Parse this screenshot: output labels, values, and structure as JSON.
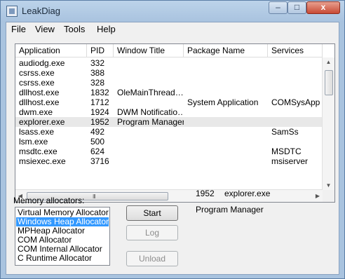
{
  "window": {
    "title": "LeakDiag",
    "controls": {
      "minimize": "–",
      "maximize": "□",
      "close": "x"
    }
  },
  "menu": [
    "File",
    "View",
    "Tools",
    "Help"
  ],
  "process_list": {
    "columns": [
      "Application",
      "PID",
      "Window Title",
      "Package Name",
      "Services"
    ],
    "rows": [
      [
        "audiodg.exe",
        "332",
        "",
        "",
        ""
      ],
      [
        "csrss.exe",
        "388",
        "",
        "",
        ""
      ],
      [
        "csrss.exe",
        "328",
        "",
        "",
        ""
      ],
      [
        "dllhost.exe",
        "1832",
        "OleMainThread…",
        "",
        ""
      ],
      [
        "dllhost.exe",
        "1712",
        "",
        "System Application",
        "COMSysApp"
      ],
      [
        "dwm.exe",
        "1924",
        "DWM Notificatio…",
        "",
        ""
      ],
      [
        "explorer.exe",
        "1952",
        "Program Manager",
        "",
        ""
      ],
      [
        "lsass.exe",
        "492",
        "",
        "",
        "SamSs"
      ],
      [
        "lsm.exe",
        "500",
        "",
        "",
        ""
      ],
      [
        "msdtc.exe",
        "624",
        "",
        "",
        "MSDTC"
      ],
      [
        "msiexec.exe",
        "3716",
        "",
        "",
        "msiserver"
      ]
    ],
    "selected_index": 6
  },
  "allocators": {
    "label": "Memory allocators:",
    "items": [
      "Virtual Memory Allocator",
      "Windows Heap Allocator",
      "MPHeap Allocator",
      "COM Allocator",
      "COM Internal Allocator",
      "C Runtime Allocator"
    ],
    "selected_index": 1
  },
  "buttons": {
    "start": "Start",
    "log": "Log",
    "unload": "Unload"
  },
  "selection_info": {
    "pid": "1952",
    "exe": "explorer.exe",
    "title": "Program Manager"
  },
  "icons": {
    "scroll_up": "▲",
    "scroll_down": "▼",
    "scroll_left": "◀",
    "scroll_right": "▶",
    "grip": "III"
  }
}
